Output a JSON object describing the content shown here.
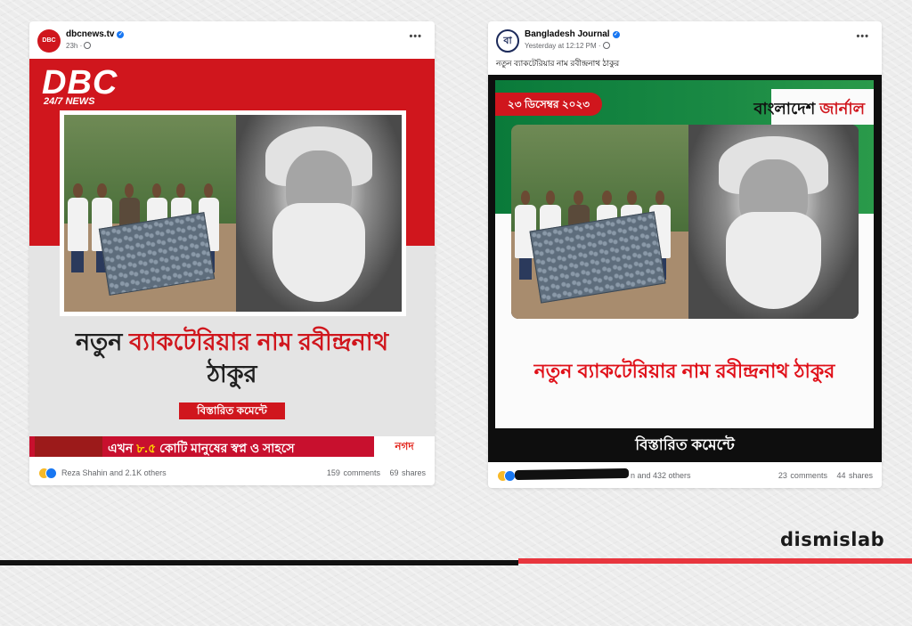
{
  "posts": [
    {
      "page_name": "dbcnews.tv",
      "time": "23h",
      "avatar_text": "DBC",
      "menu": "•••",
      "image": {
        "logo": "DBC",
        "logo_sub": "24/7 NEWS",
        "headline_part1": "নতুন ",
        "headline_part2": "ব্যাকটেরিয়ার নাম রবীন্দ্রনাথ",
        "headline_part3": "ঠাকুর",
        "cta": "বিস্তারিত কমেন্টে",
        "banner_pre": "এখন ",
        "banner_highlight": "৮.৫",
        "banner_post": " কোটি মানুষের স্বপ্ন ও সাহসে",
        "banner_brand": "নগদ"
      },
      "reactions": "Reza Shahin and 2.1K others",
      "comments": "159 comments",
      "shares": "69 shares"
    },
    {
      "page_name": "Bangladesh Journal",
      "time": "Yesterday at 12:12 PM",
      "avatar_text": "বা",
      "menu": "•••",
      "caption": "নতুন ব্যাকটেরিয়ার নাম রবীন্দ্রনাথ ঠাকুর",
      "image": {
        "date_badge": "২৩ ডিসেম্বর ২০২৩",
        "logo_part1": "বাংলাদেশ ",
        "logo_part2": "জার্নাল",
        "headline": "নতুন ব্যাকটেরিয়ার নাম রবীন্দ্রনাথ ঠাকুর",
        "cta": "বিস্তারিত কমেন্টে"
      },
      "reactions": "n and 432 others",
      "comments": "23 comments",
      "shares": "44 shares"
    }
  ],
  "brand": "dismislab",
  "colors": {
    "accent_red": "#d0161d",
    "facebook_blue": "#1877f2",
    "green": "#0a7a3a"
  },
  "icons": [
    "verified-icon",
    "globe-icon",
    "more-options-icon",
    "haha-reaction-icon",
    "like-reaction-icon"
  ]
}
